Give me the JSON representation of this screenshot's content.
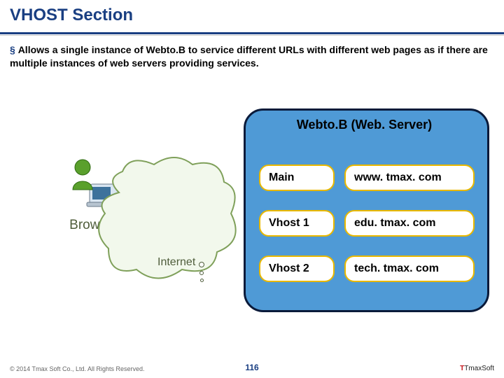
{
  "title": "VHOST Section",
  "description_bullet": "§",
  "description": "Allows a single instance of Webto.B to service different URLs with different web pages as if there are multiple instances of web servers providing services.",
  "browser_label": "Browser",
  "internet_label": "Internet",
  "server_title": "Webto.B (Web. Server)",
  "rows": [
    {
      "left": "Main",
      "right": "www. tmax. com"
    },
    {
      "left": "Vhost 1",
      "right": "edu. tmax. com"
    },
    {
      "left": "Vhost 2",
      "right": "tech. tmax. com"
    }
  ],
  "copyright": "© 2014 Tmax Soft Co., Ltd. All Rights Reserved.",
  "page_number": "116",
  "logo_text": "TmaxSoft"
}
